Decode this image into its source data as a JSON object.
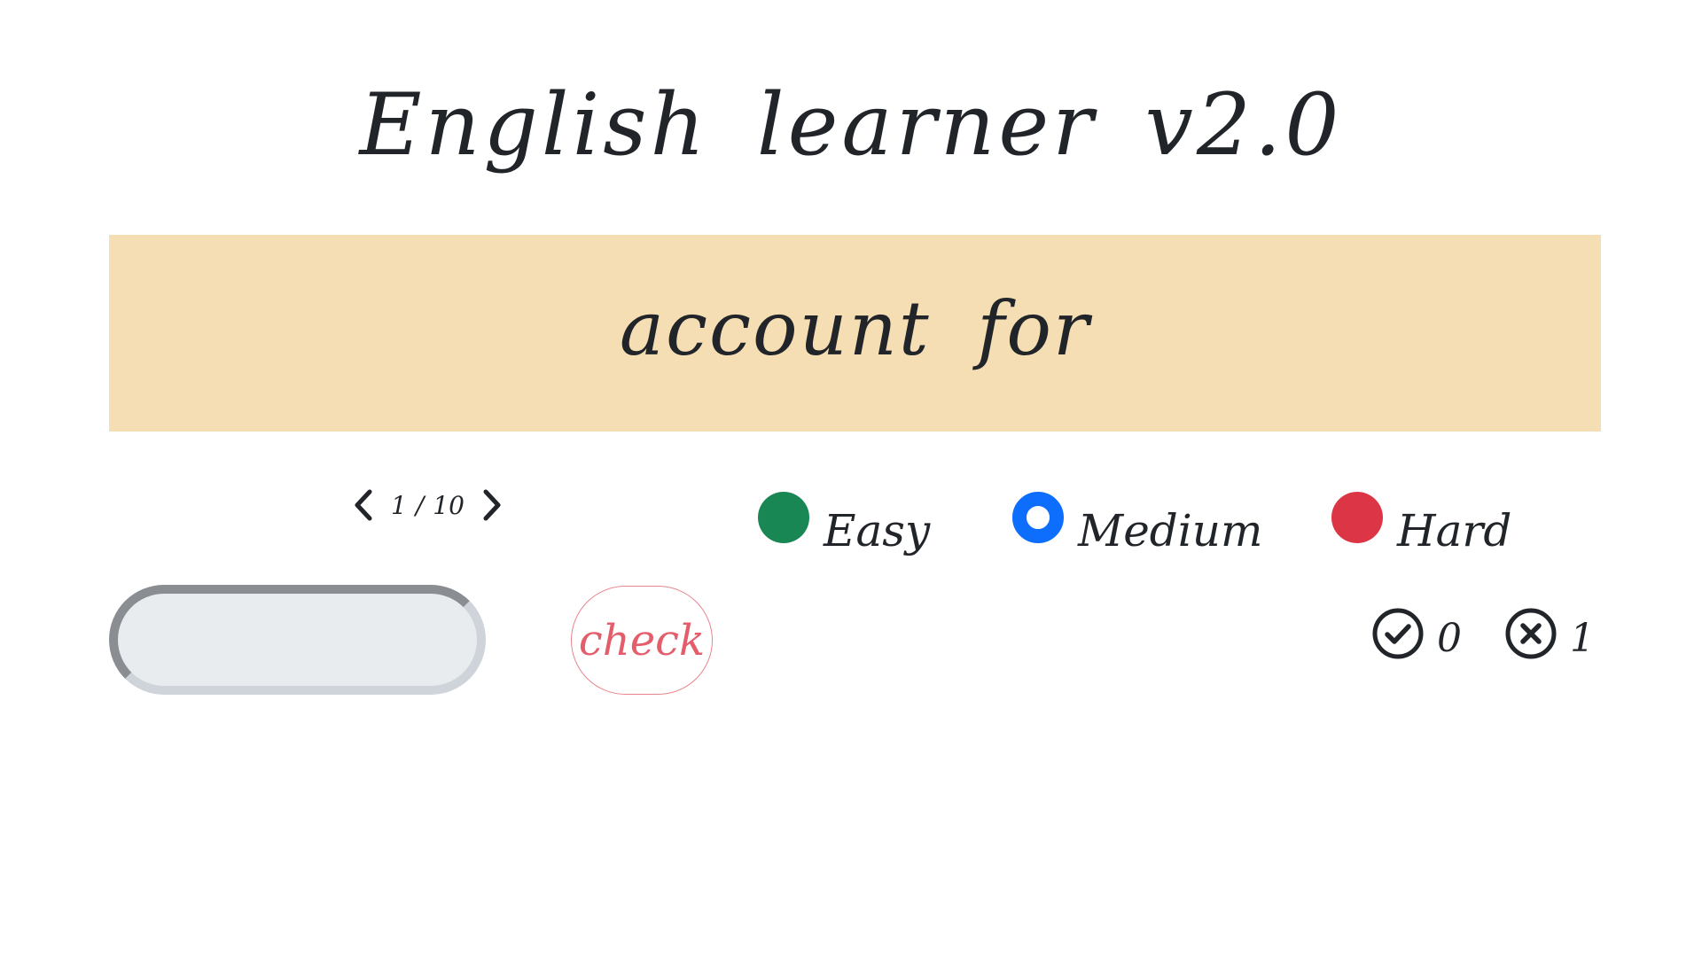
{
  "app": {
    "title": "English learner v2.0"
  },
  "card": {
    "word": "account for",
    "background": "#f5deb3"
  },
  "pager": {
    "current": "1",
    "separator": "/",
    "total": "10",
    "prev_icon": "chevron-left-icon",
    "next_icon": "chevron-right-icon"
  },
  "difficulty": {
    "options": [
      {
        "label": "Easy",
        "color": "#198754",
        "selected": false
      },
      {
        "label": "Medium",
        "color": "#0d6efd",
        "selected": true
      },
      {
        "label": "Hard",
        "color": "#dc3545",
        "selected": false
      }
    ]
  },
  "answer": {
    "value": "",
    "placeholder": ""
  },
  "check_button": {
    "label": "check",
    "color": "#e35d6a"
  },
  "score": {
    "correct_icon": "check-circle-icon",
    "correct_count": "0",
    "wrong_icon": "x-circle-icon",
    "wrong_count": "1"
  }
}
